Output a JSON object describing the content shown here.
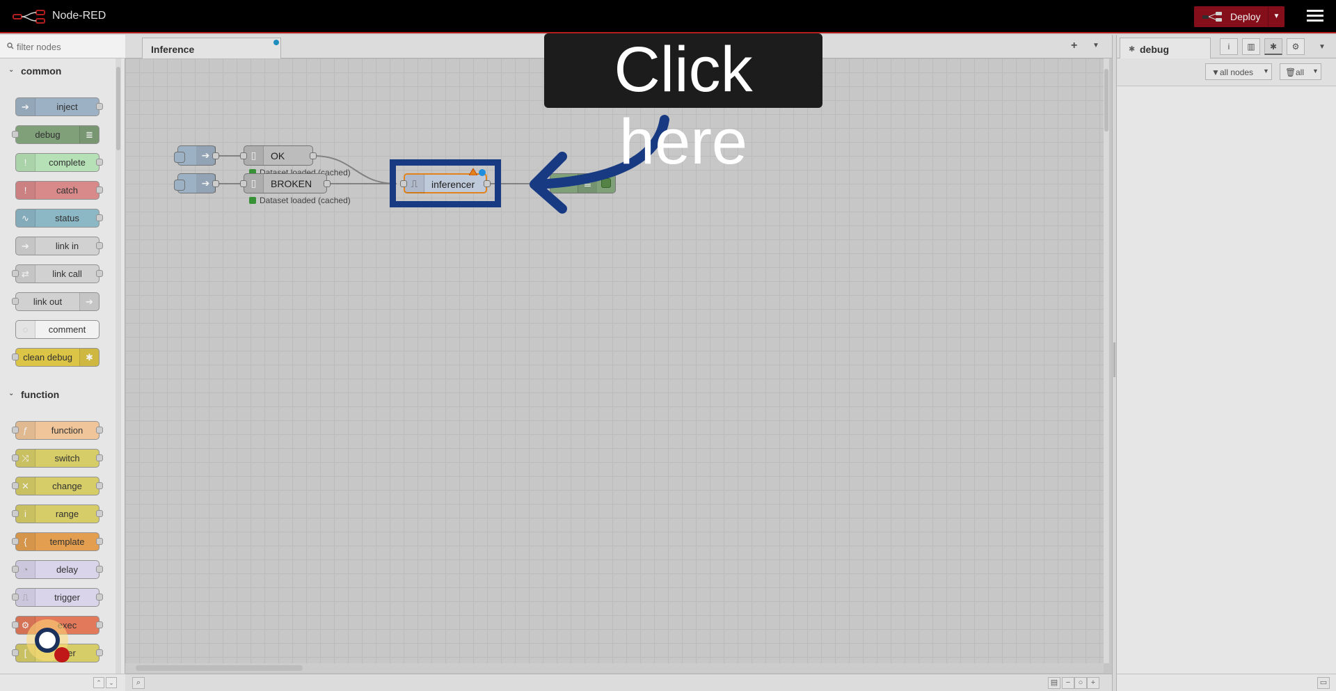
{
  "header": {
    "app_title": "Node-RED",
    "deploy_label": "Deploy"
  },
  "palette": {
    "filter_placeholder": "filter nodes",
    "categories": [
      {
        "label": "common",
        "nodes": [
          {
            "label": "inject",
            "color": "#a6bbcf"
          },
          {
            "label": "debug",
            "color": "#87a980"
          },
          {
            "label": "complete",
            "color": "#c0edc0"
          },
          {
            "label": "catch",
            "color": "#e49191"
          },
          {
            "label": "status",
            "color": "#94c1d0"
          },
          {
            "label": "link in",
            "color": "#dddddd"
          },
          {
            "label": "link call",
            "color": "#dddddd"
          },
          {
            "label": "link out",
            "color": "#dddddd"
          },
          {
            "label": "comment",
            "color": "#ffffff"
          },
          {
            "label": "clean debug",
            "color": "#e8cf4a"
          }
        ]
      },
      {
        "label": "function",
        "nodes": [
          {
            "label": "function",
            "color": "#fdd0a2"
          },
          {
            "label": "switch",
            "color": "#e2d96e"
          },
          {
            "label": "change",
            "color": "#e2d96e"
          },
          {
            "label": "range",
            "color": "#e2d96e"
          },
          {
            "label": "template",
            "color": "#f0a854"
          },
          {
            "label": "delay",
            "color": "#e6e0f8"
          },
          {
            "label": "trigger",
            "color": "#e6e0f8"
          },
          {
            "label": "exec",
            "color": "#f08060"
          },
          {
            "label": "filter",
            "color": "#e2d96e"
          }
        ]
      }
    ]
  },
  "workspace": {
    "tab_label": "Inference",
    "flow": {
      "ok_label": "OK",
      "broken_label": "BROKEN",
      "inferencer_label": "inferencer",
      "status_text": "Dataset loaded (cached)",
      "status_text_2": "Dataset loaded (cached)"
    }
  },
  "overlay": {
    "tooltip": "Click here"
  },
  "sidebar": {
    "tab_label": "debug",
    "filter_label": "all nodes",
    "clear_label": "all"
  },
  "colors": {
    "header_bg": "#000000",
    "deploy_bg": "#8c101c",
    "highlight_border": "#173a82",
    "arrow": "#173a82"
  }
}
